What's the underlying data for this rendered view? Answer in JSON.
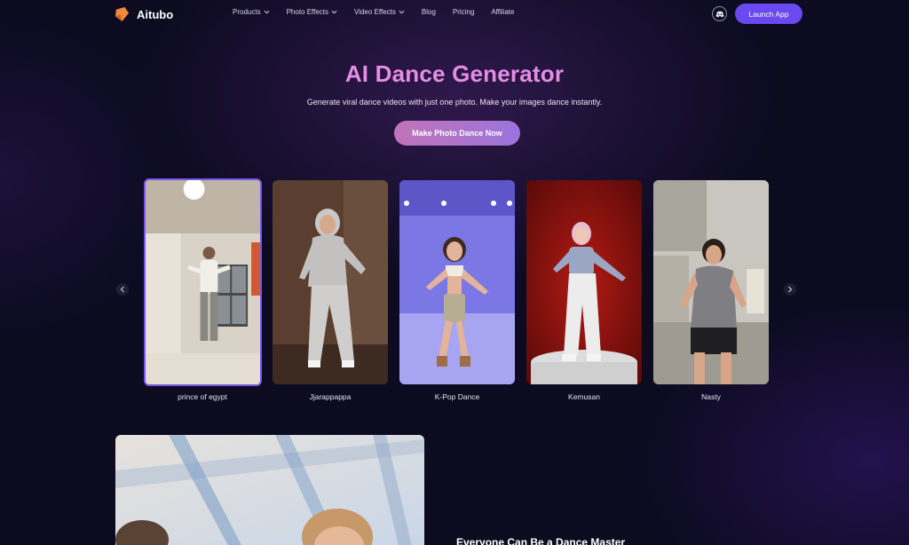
{
  "brand": {
    "name": "Aitubo",
    "logo_color": "#f08a3a"
  },
  "nav": {
    "items": [
      {
        "label": "Products",
        "dropdown": true
      },
      {
        "label": "Photo Effects",
        "dropdown": true
      },
      {
        "label": "Video Effects",
        "dropdown": true
      },
      {
        "label": "Blog",
        "dropdown": false
      },
      {
        "label": "Pricing",
        "dropdown": false
      },
      {
        "label": "Affiliate",
        "dropdown": false
      }
    ],
    "discord_icon": "discord-icon",
    "launch_label": "Launch App"
  },
  "hero": {
    "title": "AI Dance Generator",
    "subtitle": "Generate viral dance videos with just one photo. Make your images dance instantly.",
    "cta_label": "Make Photo Dance Now"
  },
  "carousel": {
    "prev_icon": "chevron-left-icon",
    "next_icon": "chevron-right-icon",
    "cards": [
      {
        "label": "prince of egypt",
        "active": true
      },
      {
        "label": "Jjarappappa",
        "active": false
      },
      {
        "label": "K-Pop Dance",
        "active": false
      },
      {
        "label": "Kemusan",
        "active": false
      },
      {
        "label": "Nasty",
        "active": false
      }
    ]
  },
  "section": {
    "title": "Everyone Can Be a Dance Master"
  },
  "colors": {
    "accent": "#6a49f0",
    "title_pink": "#e58de6",
    "background": "#0c0b20"
  }
}
